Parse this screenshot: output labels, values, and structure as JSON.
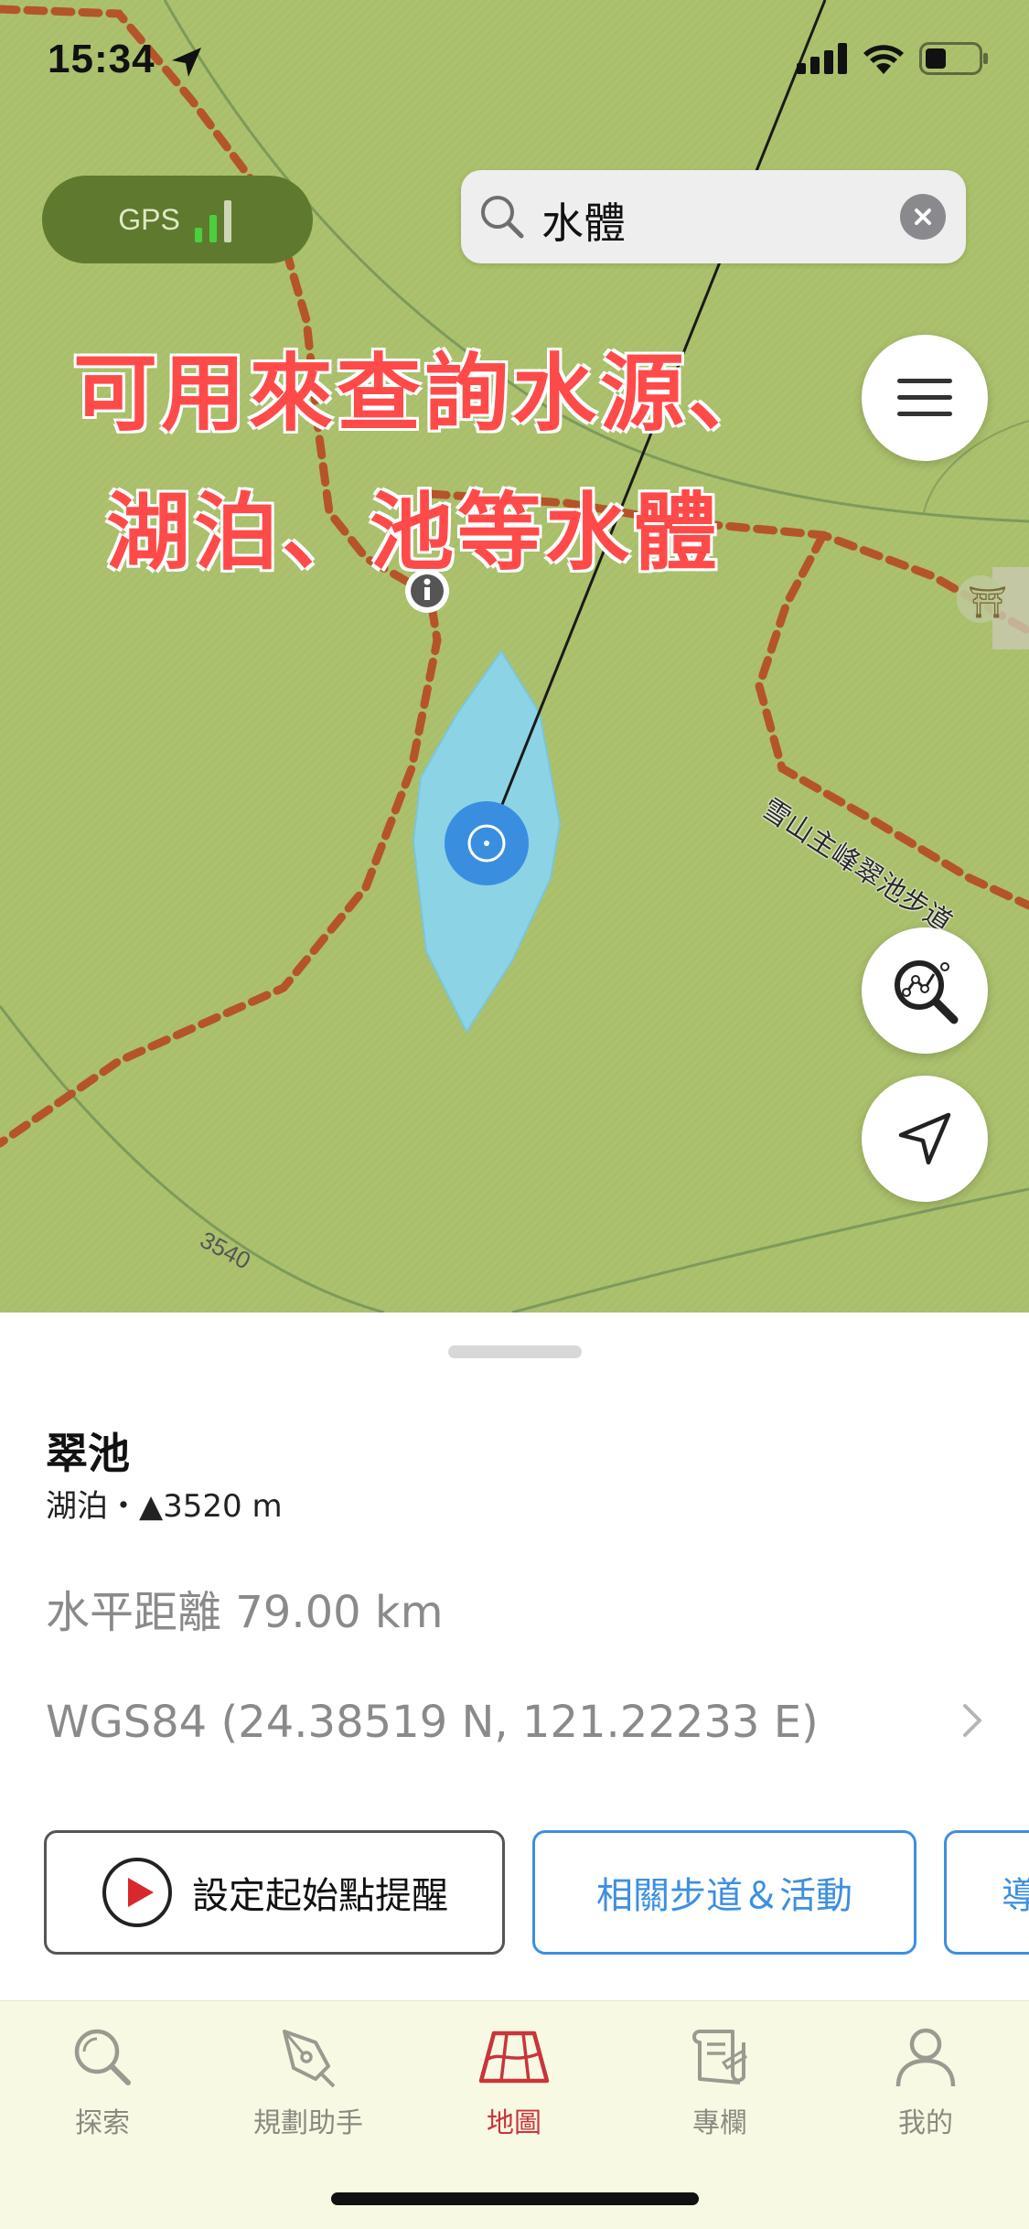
{
  "status_bar": {
    "time": "15:34"
  },
  "map": {
    "gps_label": "GPS",
    "search": {
      "query": "水體"
    },
    "caption_lines": [
      "可用來查詢水源、",
      "湖泊、池等水體"
    ],
    "trail_label": "雪山主峰翠池步道",
    "contour_label": "3540",
    "buttons": {
      "menu": "menu-icon",
      "route_search": "route-search-icon",
      "locate": "navigation-arrow-icon"
    },
    "colors": {
      "terrain": "#a9bf6a",
      "trail": "#b5542a",
      "water": "#8dd3e6",
      "location": "#3a8ee0"
    }
  },
  "sheet": {
    "name": "翠池",
    "meta": "湖泊・▲3520 m",
    "distance": "水平距離 79.00 km",
    "coordinates": "WGS84 (24.38519 N, 121.22233 E)",
    "buttons": {
      "reminder": "設定起始點提醒",
      "related": "相關步道＆活動",
      "navigate": "導"
    }
  },
  "tabbar": {
    "active": "地圖",
    "tabs": [
      {
        "label": "探索",
        "icon": "search-icon"
      },
      {
        "label": "規劃助手",
        "icon": "pen-icon"
      },
      {
        "label": "地圖",
        "icon": "map-icon"
      },
      {
        "label": "專欄",
        "icon": "scroll-icon"
      },
      {
        "label": "我的",
        "icon": "person-icon"
      }
    ]
  }
}
